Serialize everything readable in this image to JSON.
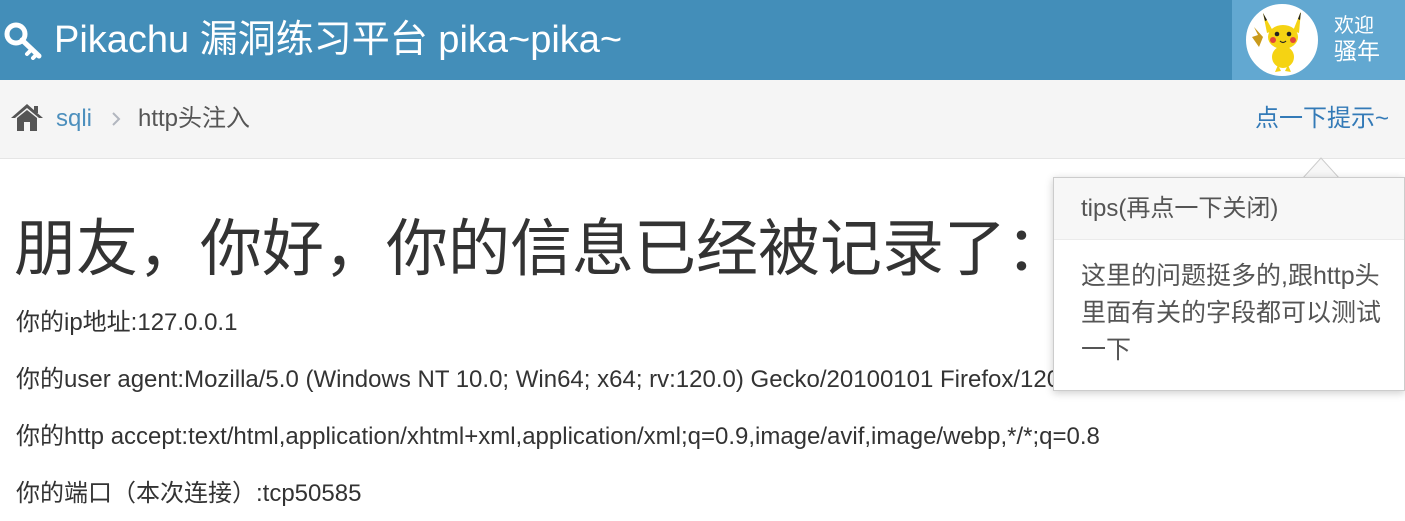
{
  "header": {
    "brand_title": "Pikachu 漏洞练习平台 pika~pika~",
    "welcome_line1": "欢迎",
    "welcome_line2": "骚年",
    "brand_color": "#438eb9",
    "user_box_color": "#62a8d1"
  },
  "breadcrumb": {
    "home_icon": "home-icon",
    "parent_label": "sqli",
    "current_label": "http头注入",
    "hint_label": "点一下提示~"
  },
  "main": {
    "headline": "朋友，你好，你的信息已经被记录了：",
    "lines": [
      "你的ip地址:127.0.0.1",
      "你的user agent:Mozilla/5.0 (Windows NT 10.0; Win64; x64; rv:120.0) Gecko/20100101 Firefox/120.0",
      "你的http accept:text/html,application/xhtml+xml,application/xml;q=0.9,image/avif,image/webp,*/*;q=0.8",
      "你的端口（本次连接）:tcp50585"
    ]
  },
  "popover": {
    "title": "tips(再点一下关闭)",
    "content": "这里的问题挺多的,跟http头里面有关的字段都可以测试一下"
  }
}
